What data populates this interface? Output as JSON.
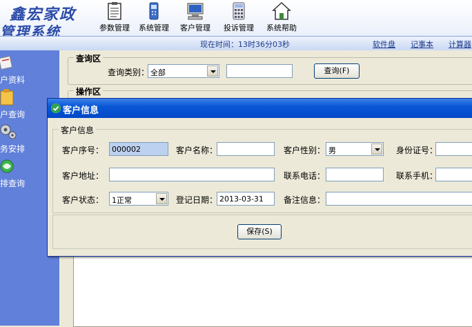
{
  "app": {
    "logo_line1": "鑫宏家政",
    "logo_line2": "管理系统"
  },
  "toolbar": {
    "items": [
      {
        "label": "参数管理",
        "icon": "clipboard-icon"
      },
      {
        "label": "系统管理",
        "icon": "phone-icon"
      },
      {
        "label": "客户管理",
        "icon": "computer-icon"
      },
      {
        "label": "投诉管理",
        "icon": "calculator-icon"
      },
      {
        "label": "系统帮助",
        "icon": "home-icon"
      }
    ]
  },
  "statusbar": {
    "time_text": "现在时间：13时36分03秒",
    "links": [
      "软件盘",
      "记事本",
      "计算器"
    ]
  },
  "sidebar": {
    "items": [
      {
        "label": "户资料",
        "icon": "customer-profile-icon"
      },
      {
        "label": "户查询",
        "icon": "customer-query-icon"
      },
      {
        "label": "务安排",
        "icon": "service-schedule-icon"
      },
      {
        "label": "排查询",
        "icon": "schedule-query-icon"
      }
    ]
  },
  "query": {
    "group_title": "查询区",
    "category_label": "查询类别：",
    "category_value": "全部",
    "keyword_value": "",
    "button_label": "查询(F)"
  },
  "operation": {
    "group_title": "操作区"
  },
  "dialog": {
    "title": "客户信息",
    "group_title": "客户信息",
    "fields": {
      "customer_id": {
        "label": "客户序号：",
        "value": "000002"
      },
      "customer_name": {
        "label": "客户名称：",
        "value": ""
      },
      "gender": {
        "label": "客户性别：",
        "value": "男"
      },
      "id_card": {
        "label": "身份证号：",
        "value": ""
      },
      "address": {
        "label": "客户地址：",
        "value": ""
      },
      "phone": {
        "label": "联系电话：",
        "value": ""
      },
      "mobile": {
        "label": "联系手机：",
        "value": ""
      },
      "status": {
        "label": "客户状态：",
        "value": "1正常"
      },
      "reg_date": {
        "label": "登记日期：",
        "value": "2013-03-31"
      },
      "remarks": {
        "label": "备注信息：",
        "value": ""
      }
    },
    "save_label": "保存(S)"
  },
  "colors": {
    "sidebar_bg": "#6180d9",
    "title_bar": "#0a57d6",
    "window_bg": "#ECE9D8"
  }
}
